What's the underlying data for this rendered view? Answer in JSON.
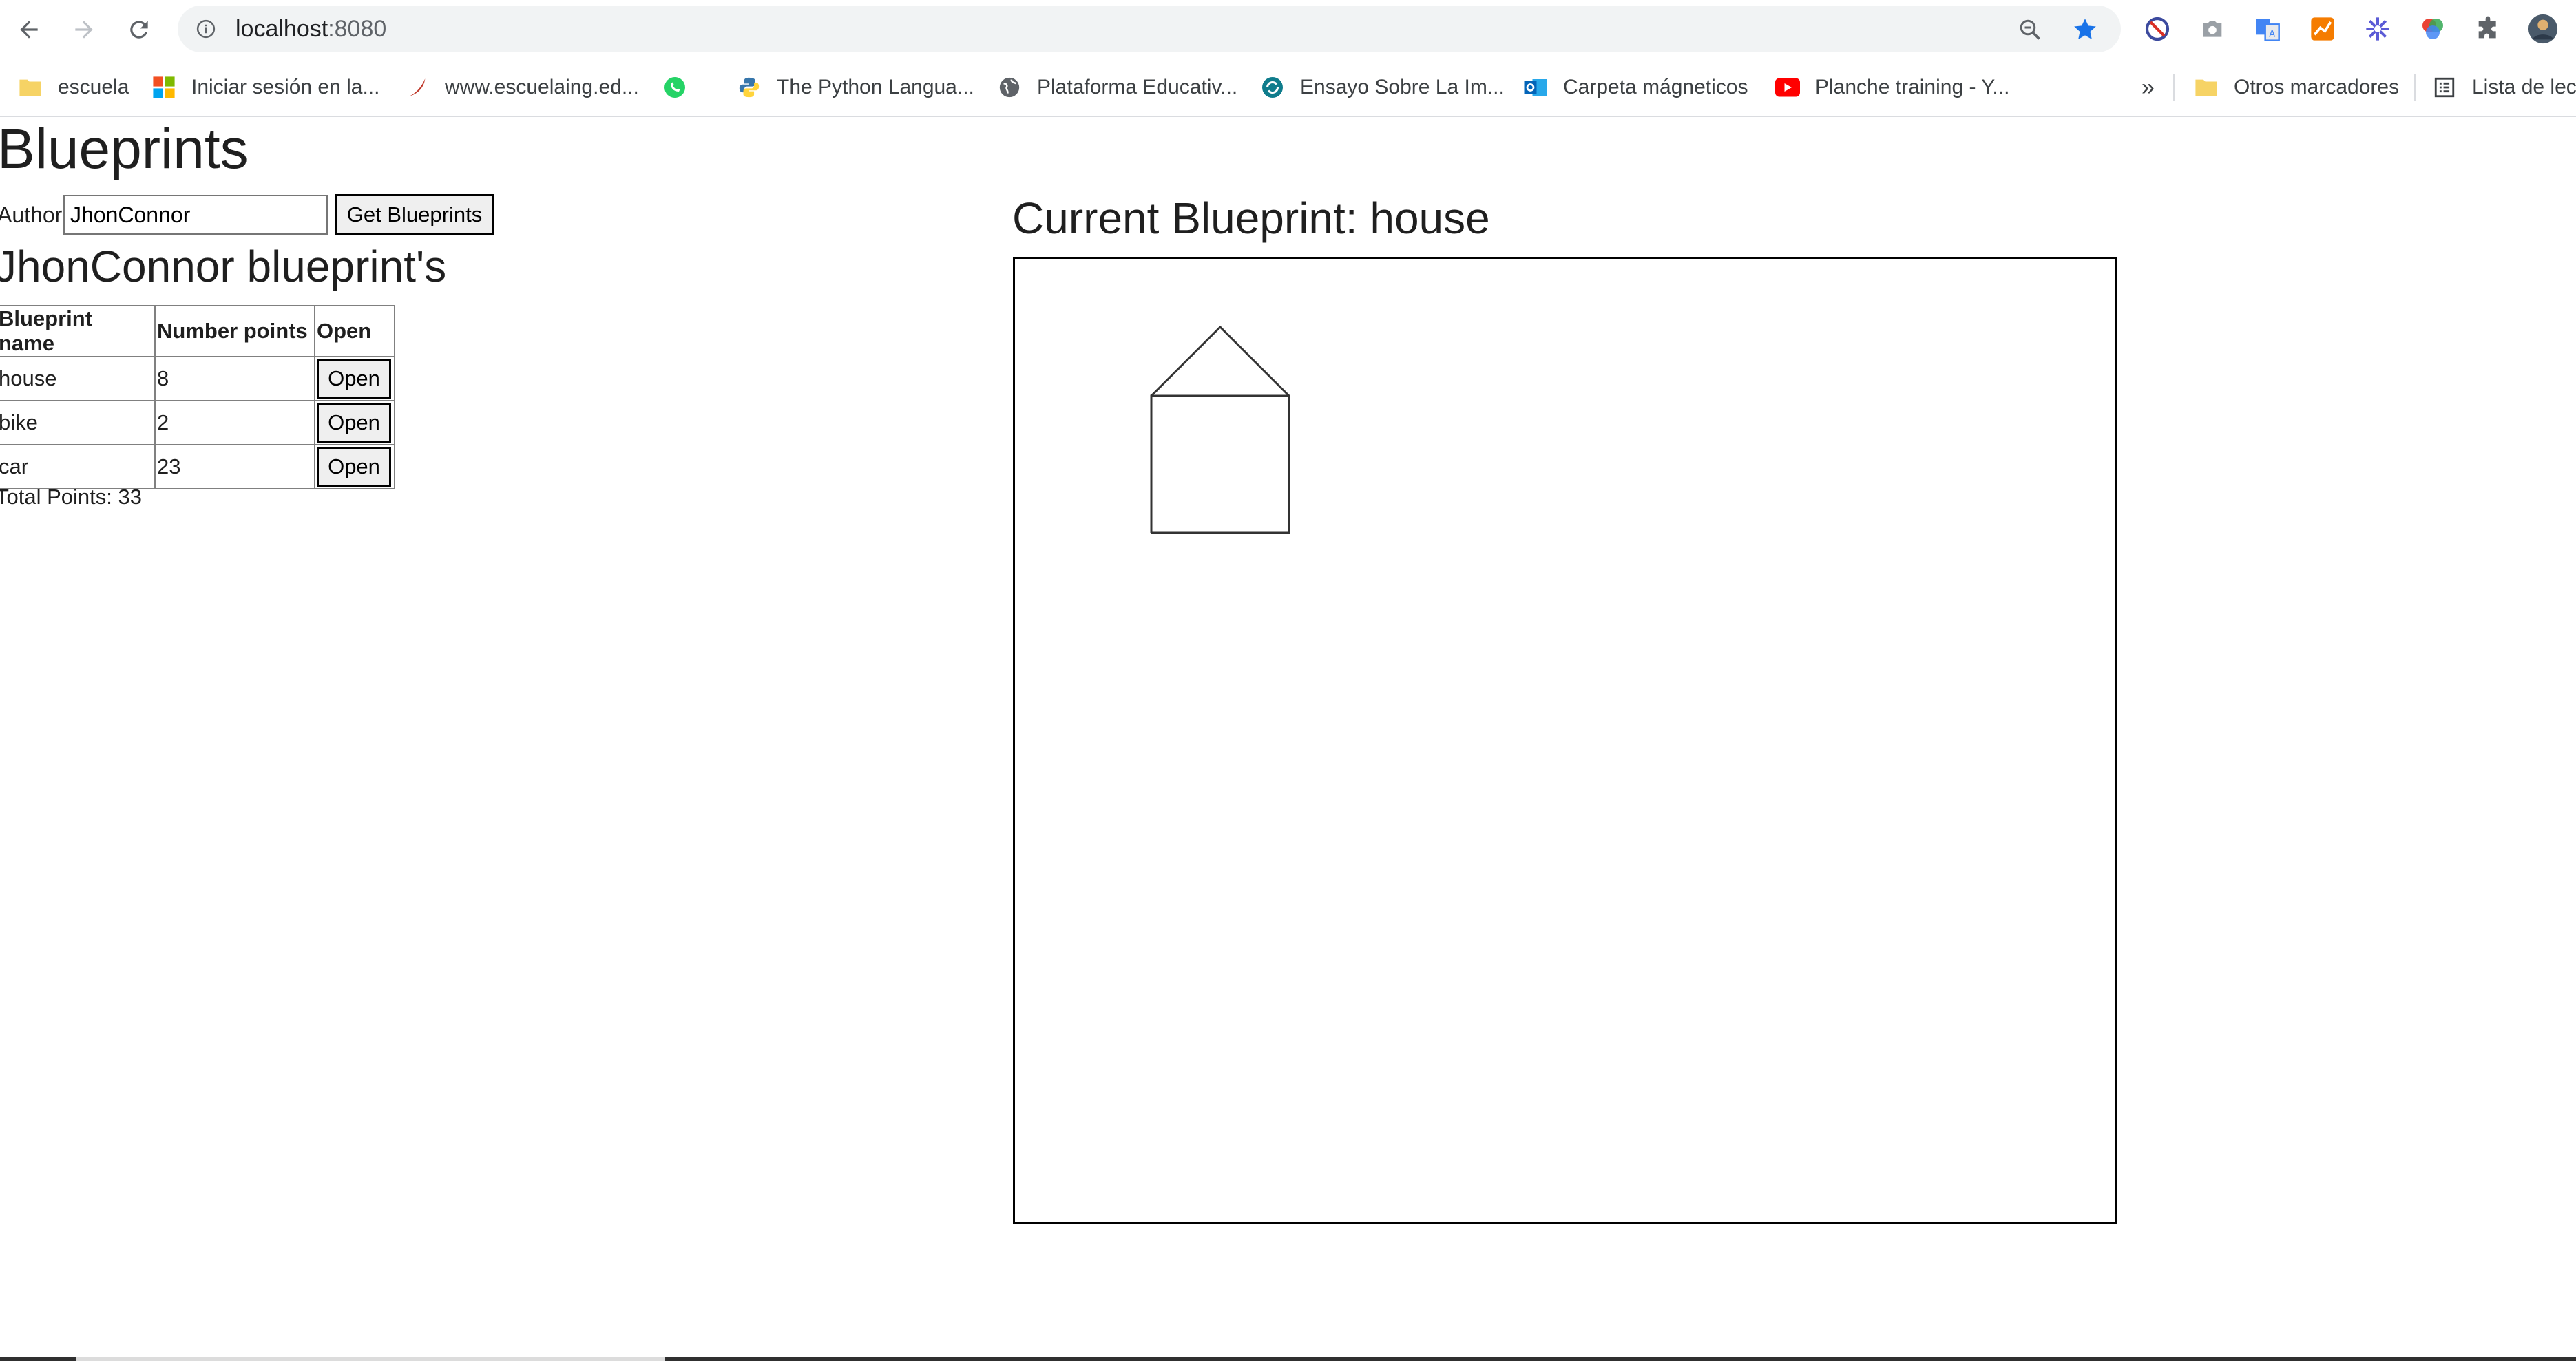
{
  "browser": {
    "url_host": "localhost",
    "url_port": ":8080",
    "bookmarks": [
      {
        "label": "escuela",
        "icon": "folder-icon"
      },
      {
        "label": "Iniciar sesión en la...",
        "icon": "microsoft-icon"
      },
      {
        "label": "www.escuelaing.ed...",
        "icon": "escuelaing-icon"
      },
      {
        "label": "",
        "icon": "whatsapp-icon"
      },
      {
        "label": "The Python Langua...",
        "icon": "python-icon"
      },
      {
        "label": "Plataforma Educativ...",
        "icon": "globe-icon"
      },
      {
        "label": "Ensayo Sobre La Im...",
        "icon": "refresh-globe-icon"
      },
      {
        "label": "Carpeta mágneticos",
        "icon": "outlook-icon"
      },
      {
        "label": "Planche training - Y...",
        "icon": "youtube-icon"
      }
    ],
    "overflow_label": "»",
    "other_bookmarks": "Otros marcadores",
    "reading_list": "Lista de lec"
  },
  "page": {
    "title": "Blueprints",
    "author_label": "Author",
    "author_value": "JhonConnor",
    "get_button": "Get Blueprints",
    "list_heading": "JhonConnor blueprint's",
    "table": {
      "headers": [
        "Blueprint name",
        "Number points",
        "Open"
      ],
      "rows": [
        {
          "name": "house",
          "points": "8",
          "action": "Open"
        },
        {
          "name": "bike",
          "points": "2",
          "action": "Open"
        },
        {
          "name": "car",
          "points": "23",
          "action": "Open"
        }
      ]
    },
    "total": "Total Points: 33",
    "current_heading": "Current Blueprint: house"
  }
}
